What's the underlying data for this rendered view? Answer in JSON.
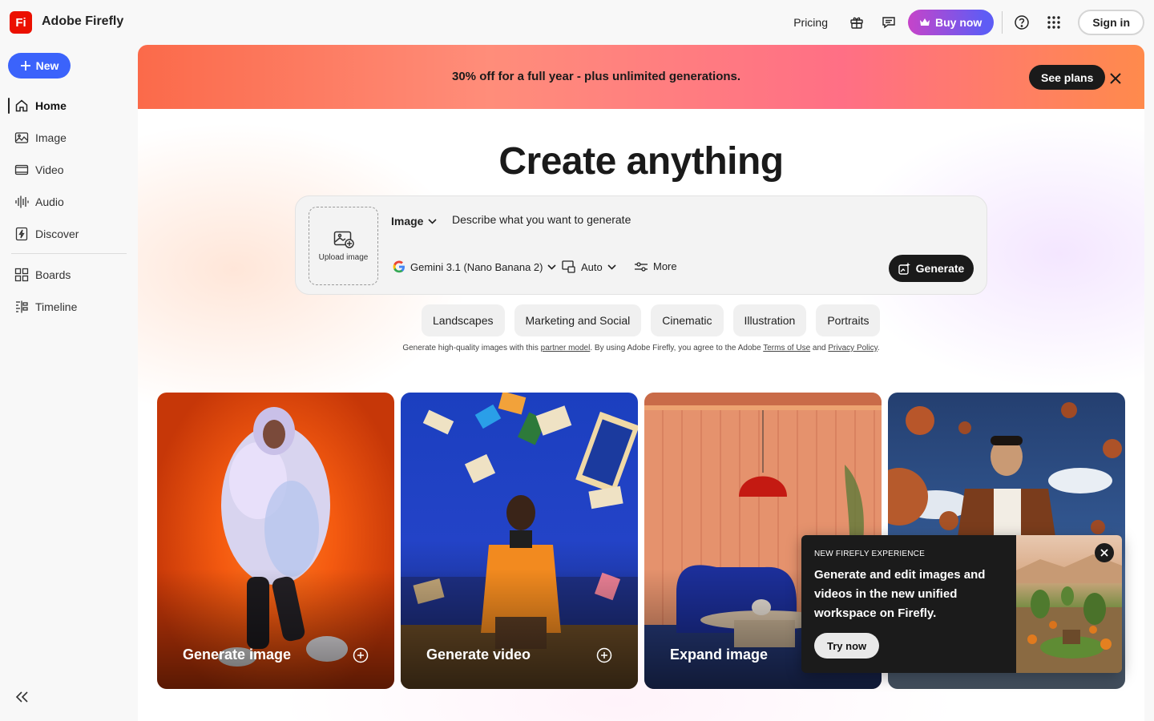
{
  "header": {
    "app_title": "Adobe Firefly",
    "logo_text": "Fi",
    "pricing": "Pricing",
    "buy_now": "Buy now",
    "sign_in": "Sign in"
  },
  "sidebar": {
    "new_label": "New",
    "items": [
      {
        "label": "Home",
        "icon": "home-icon",
        "active": true
      },
      {
        "label": "Image",
        "icon": "image-icon"
      },
      {
        "label": "Video",
        "icon": "video-icon"
      },
      {
        "label": "Audio",
        "icon": "audio-icon"
      },
      {
        "label": "Discover",
        "icon": "discover-icon"
      },
      {
        "label": "Boards",
        "icon": "boards-icon"
      },
      {
        "label": "Timeline",
        "icon": "timeline-icon"
      }
    ]
  },
  "promo": {
    "text": "30% off for a full year  - plus unlimited generations.",
    "see_plans": "See plans"
  },
  "hero": {
    "title": "Create anything"
  },
  "prompt": {
    "upload_label": "Upload image",
    "type": "Image",
    "placeholder": "Describe what you want to generate",
    "model": "Gemini 3.1 (Nano Banana 2)",
    "aspect": "Auto",
    "more": "More",
    "generate": "Generate"
  },
  "chips": [
    "Landscapes",
    "Marketing and Social",
    "Cinematic",
    "Illustration",
    "Portraits"
  ],
  "disclaimer": {
    "part1": "Generate high-quality images with this ",
    "partner_link": "partner model",
    "part2": ". By using Adobe Firefly, you agree to the Adobe ",
    "terms_link": "Terms of Use",
    "part3": " and ",
    "privacy_link": "Privacy Policy",
    "part4": "."
  },
  "cards": [
    {
      "label": "Generate image"
    },
    {
      "label": "Generate video"
    },
    {
      "label": "Expand image"
    },
    {
      "label": ""
    }
  ],
  "popup": {
    "kicker": "NEW FIREFLY EXPERIENCE",
    "body": "Generate and edit images and videos in the new unified workspace on Firefly.",
    "cta": "Try now"
  },
  "colors": {
    "accent_blue": "#3b63fb",
    "brand_red": "#eb1000",
    "dark": "#1a1a1a"
  }
}
